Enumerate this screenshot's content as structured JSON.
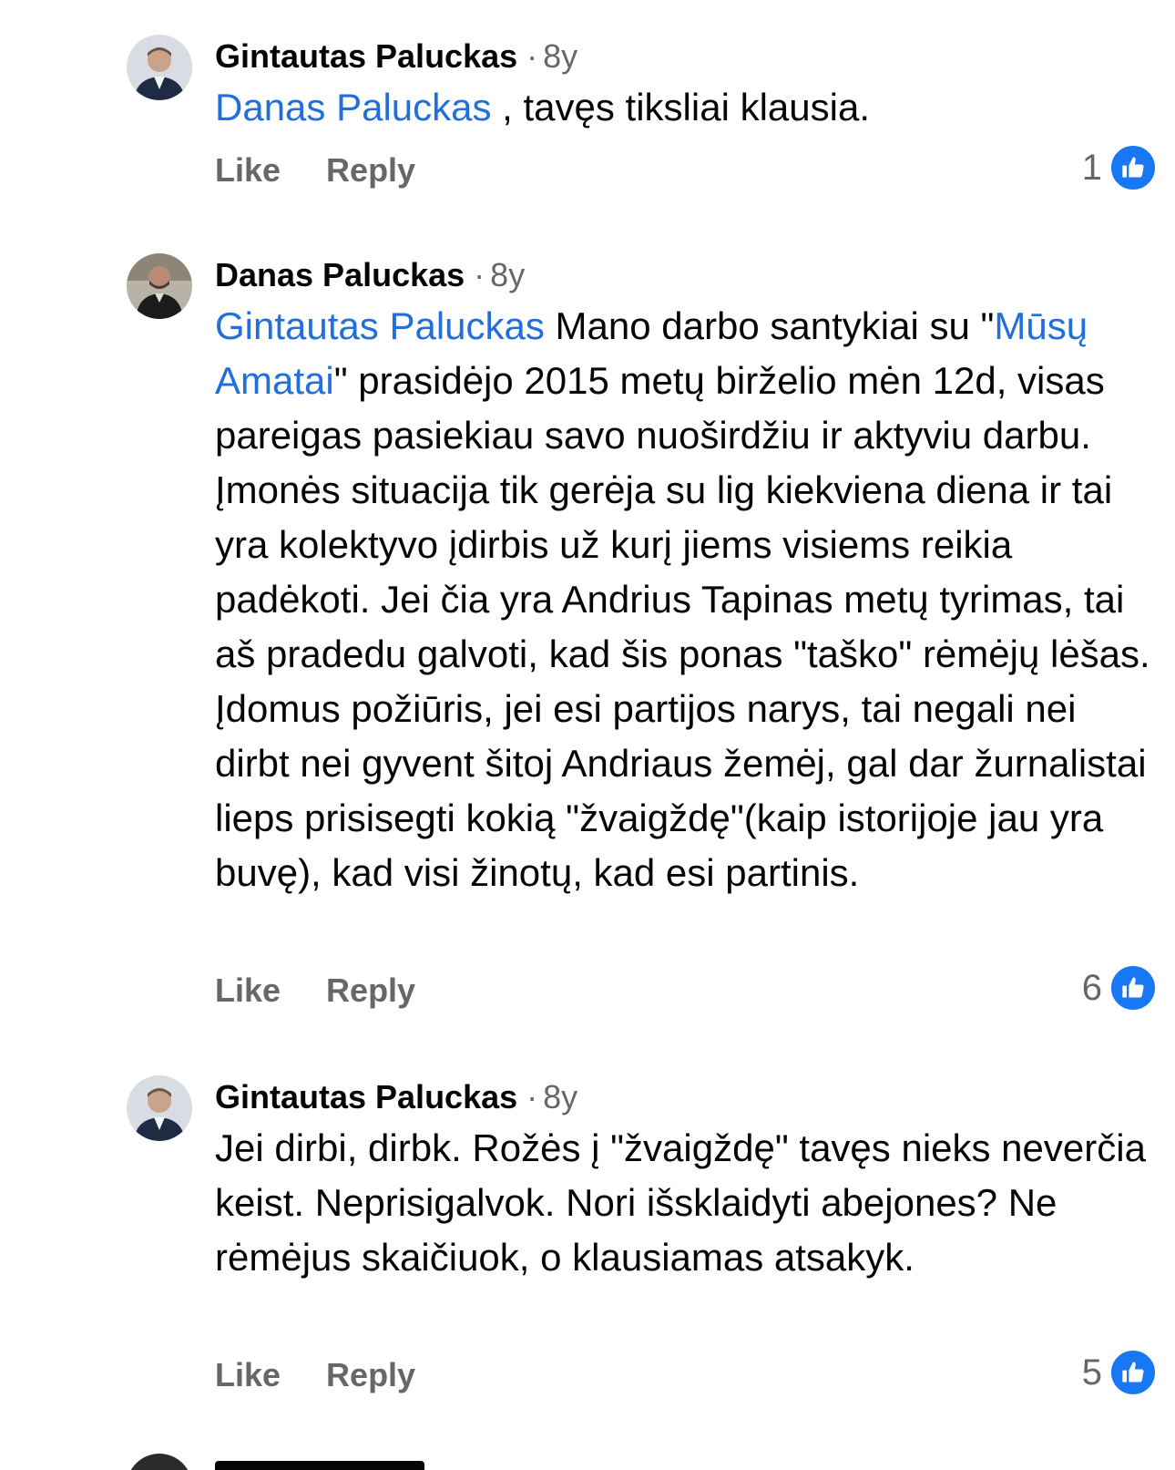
{
  "comments": [
    {
      "author": "Gintautas Paluckas",
      "time": "8y",
      "mention": "Danas Paluckas",
      "text": " , tavęs tiksliai klausia.",
      "like_label": "Like",
      "reply_label": "Reply",
      "reaction_count": "1"
    },
    {
      "author": "Danas Paluckas",
      "time": "8y",
      "mention": "Gintautas Paluckas",
      "text_a": " Mano darbo santykiai su \"",
      "mention2": "Mūsų Amatai",
      "text_b": "\" prasidėjo 2015 metų birželio mėn 12d, visas pareigas pasiekiau savo nuoširdžiu ir aktyviu darbu. Įmonės situacija tik gerėja su lig kiekviena diena ir tai yra kolektyvo įdirbis už kurį jiems visiems reikia padėkoti. Jei čia yra Andrius Tapinas metų tyrimas, tai aš pradedu galvoti, kad šis ponas \"taško\" rėmėjų lėšas. Įdomus požiūris, jei esi partijos narys, tai negali nei dirbt nei gyvent šitoj Andriaus žemėj, gal dar žurnalistai lieps prisisegti kokią \"žvaigždę\"(kaip istorijoje jau yra buvę), kad visi žinotų, kad esi partinis.",
      "like_label": "Like",
      "reply_label": "Reply",
      "reaction_count": "6"
    },
    {
      "author": "Gintautas Paluckas",
      "time": "8y",
      "text": "Jei dirbi, dirbk. Rožės į \"žvaigždę\" tavęs nieks neverčia keist. Neprisigalvok. Nori išsklaidyti abejones? Ne rėmėjus skaičiuok, o klausiamas atsakyk.",
      "like_label": "Like",
      "reply_label": "Reply",
      "reaction_count": "5"
    }
  ],
  "separator": "·",
  "colors": {
    "mention": "#216fdb",
    "like_badge": "#1877f2",
    "secondary_text": "#65676b"
  },
  "icons": {
    "reaction": "like-thumb-icon"
  }
}
